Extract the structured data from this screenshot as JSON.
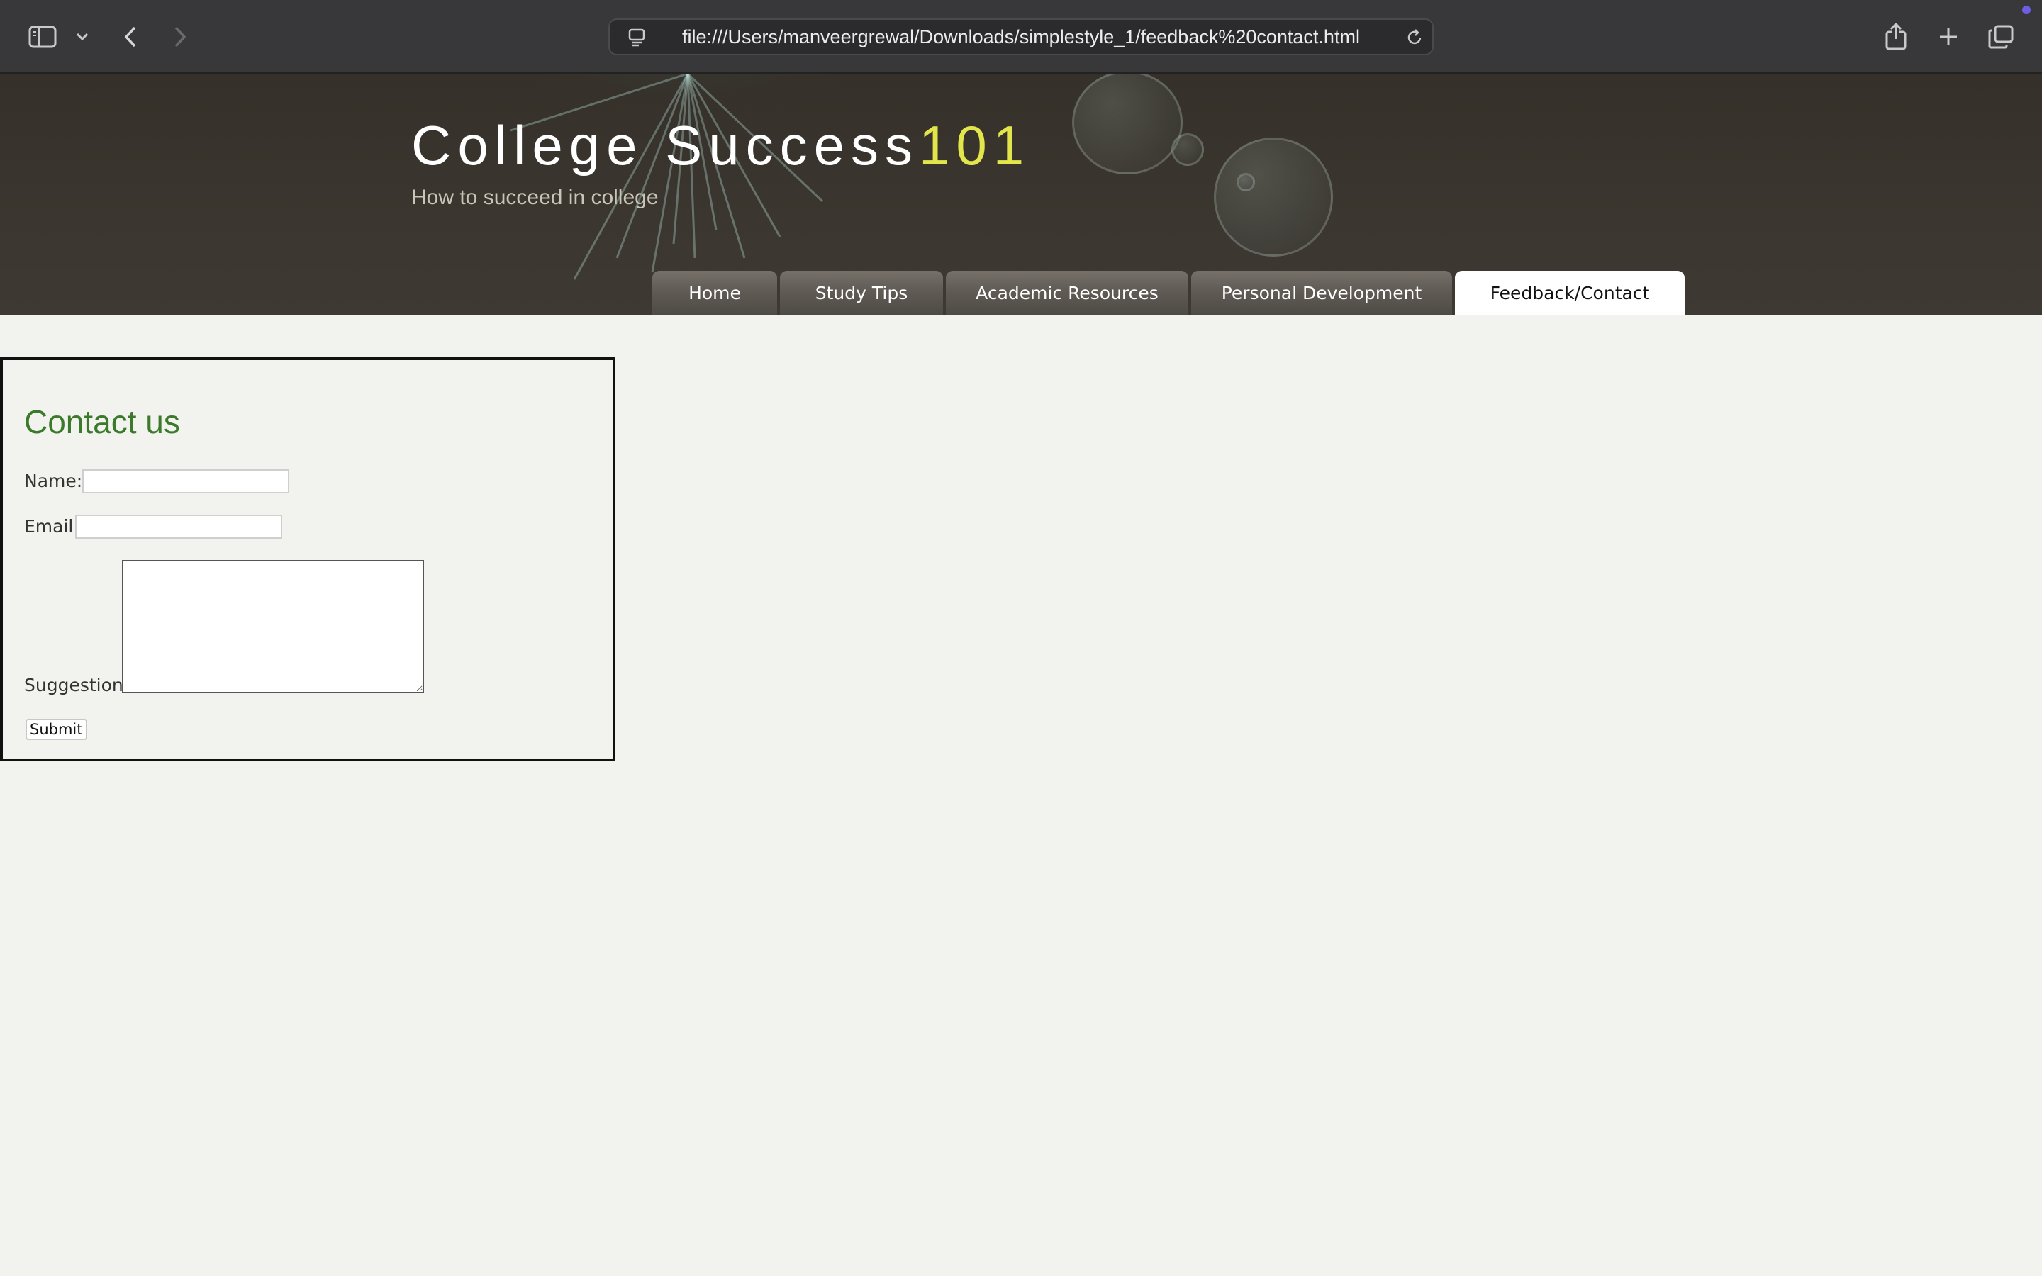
{
  "browser": {
    "url": "file:///Users/manveergrewal/Downloads/simplestyle_1/feedback%20contact.html",
    "icons": {
      "sidebar": "sidebar-icon",
      "sidebar_menu": "chevron-down-icon",
      "back": "chevron-left-icon",
      "forward": "chevron-right-icon",
      "page_menu": "page-menu-icon",
      "reload": "reload-icon",
      "share": "share-icon",
      "new_tab": "plus-icon",
      "tab_overview": "tab-overview-icon"
    }
  },
  "site": {
    "title_main": "College Success",
    "title_accent": "101",
    "subtitle": "How to succeed in college",
    "accent_color": "#e3e64a"
  },
  "nav": {
    "items": [
      {
        "label": "Home",
        "active": false
      },
      {
        "label": "Study Tips",
        "active": false
      },
      {
        "label": "Academic Resources",
        "active": false
      },
      {
        "label": "Personal Development",
        "active": false
      },
      {
        "label": "Feedback/Contact",
        "active": true
      }
    ]
  },
  "contact": {
    "title": "Contact us",
    "title_color": "#3a7a2a",
    "name_label": "Name:",
    "name_value": "",
    "email_label": "Email",
    "email_value": "",
    "suggestion_label": "Suggestion:",
    "suggestion_value": "",
    "submit_label": "Submit"
  }
}
